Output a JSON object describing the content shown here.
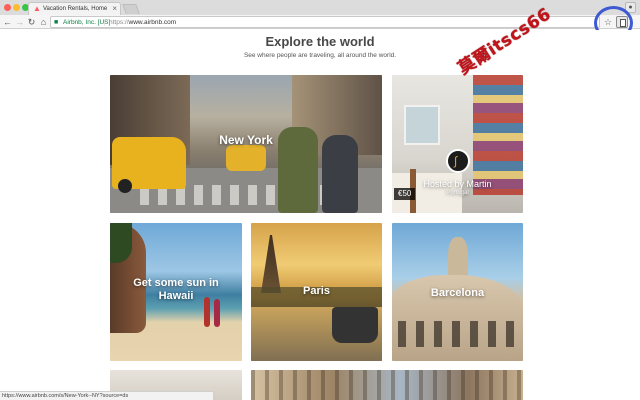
{
  "browser": {
    "tab_title": "Vacation Rentals, Homes, Apa",
    "tab_close": "×",
    "site_identity": "Airbnb, Inc. [US]",
    "url_separator": "|",
    "url_scheme": "https://",
    "url_host": "www.airbnb.com",
    "status_url": "https://www.airbnb.com/s/New-York--NY?source=ds"
  },
  "icons": {
    "back": "back-arrow-icon",
    "forward": "forward-arrow-icon",
    "reload": "reload-icon",
    "home": "home-icon",
    "lock": "lock-icon",
    "star": "star-icon",
    "extension": "extension-icon",
    "profile": "profile-icon",
    "airbnb": "airbnb-logo-icon"
  },
  "page": {
    "title": "Explore the world",
    "subtitle": "See where people are traveling, all around the world."
  },
  "cards": {
    "new_york": "New York",
    "host_name": "Hosted by Martin",
    "host_sub": "Portugal",
    "host_price": "€50",
    "hawaii_line1": "Get some sun in",
    "hawaii_line2": "Hawaii",
    "paris": "Paris",
    "barcelona": "Barcelona"
  },
  "watermark": "莫爾itscs66",
  "colors": {
    "airbnb_accent": "#ff5a5f",
    "secure_green": "#0b8043",
    "highlight_blue": "#3d5ad3",
    "watermark_red": "#c0141b"
  }
}
